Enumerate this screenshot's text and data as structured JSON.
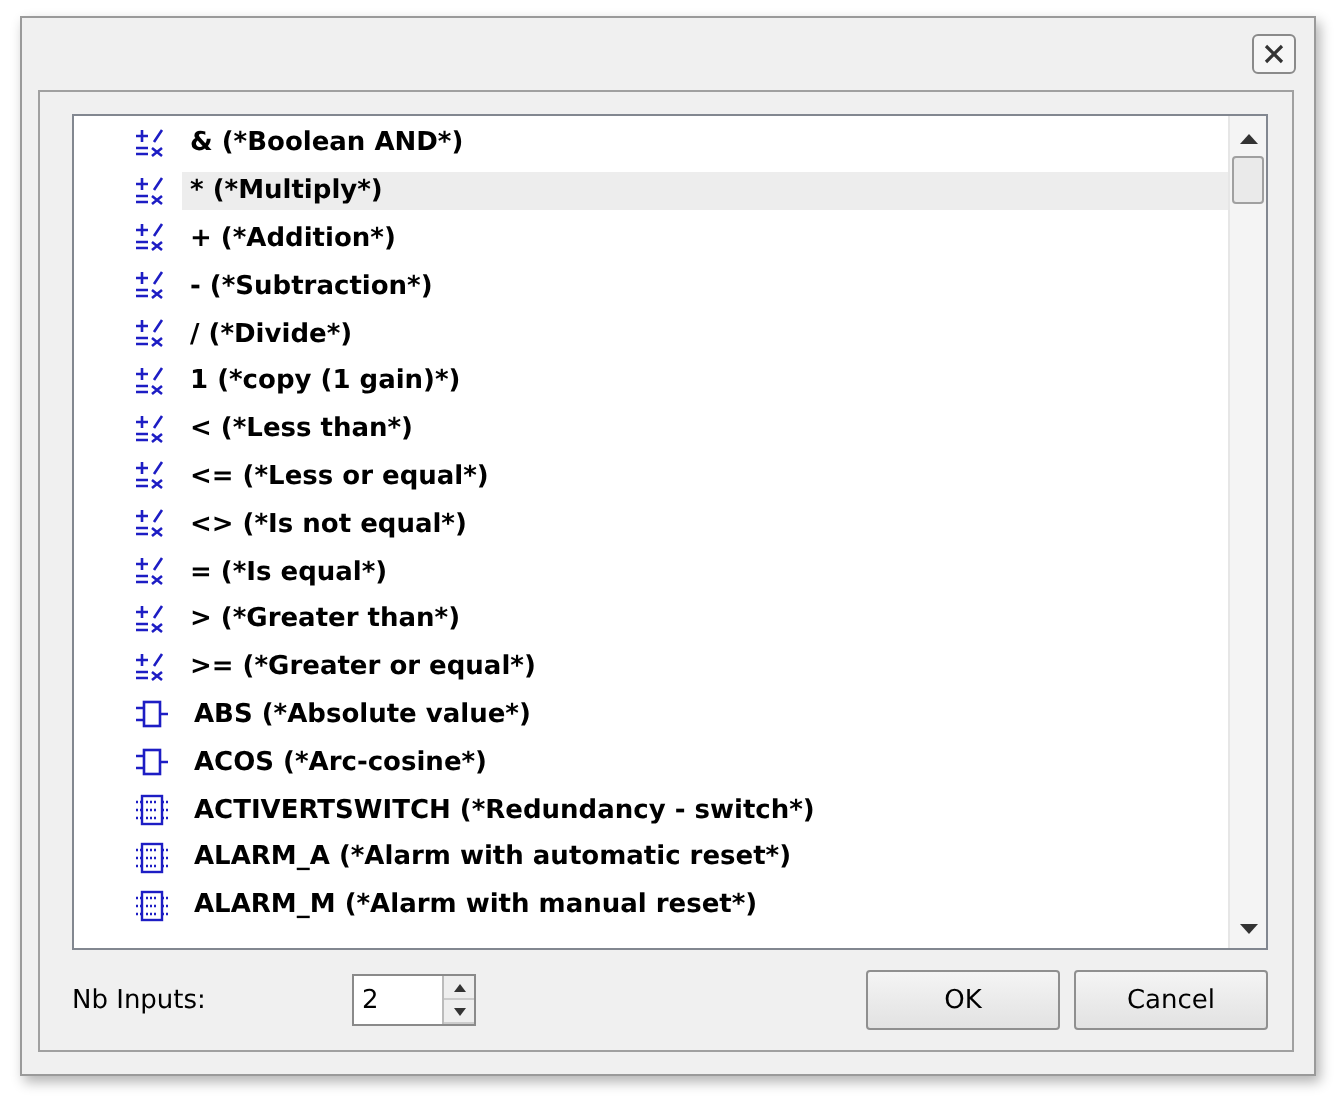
{
  "items": [
    {
      "kind": "operator",
      "label": "& (*Boolean AND*)",
      "selected": false
    },
    {
      "kind": "operator",
      "label": "* (*Multiply*)",
      "selected": true
    },
    {
      "kind": "operator",
      "label": "+ (*Addition*)",
      "selected": false
    },
    {
      "kind": "operator",
      "label": "- (*Subtraction*)",
      "selected": false
    },
    {
      "kind": "operator",
      "label": "/ (*Divide*)",
      "selected": false
    },
    {
      "kind": "operator",
      "label": "1 (*copy (1 gain)*)",
      "selected": false
    },
    {
      "kind": "operator",
      "label": "< (*Less than*)",
      "selected": false
    },
    {
      "kind": "operator",
      "label": "<= (*Less or equal*)",
      "selected": false
    },
    {
      "kind": "operator",
      "label": "<> (*Is not equal*)",
      "selected": false
    },
    {
      "kind": "operator",
      "label": "= (*Is equal*)",
      "selected": false
    },
    {
      "kind": "operator",
      "label": "> (*Greater than*)",
      "selected": false
    },
    {
      "kind": "operator",
      "label": ">= (*Greater or equal*)",
      "selected": false
    },
    {
      "kind": "function",
      "label": "ABS (*Absolute value*)",
      "selected": false
    },
    {
      "kind": "function",
      "label": "ACOS (*Arc-cosine*)",
      "selected": false
    },
    {
      "kind": "block",
      "label": "ACTIVERTSWITCH (*Redundancy - switch*)",
      "selected": false
    },
    {
      "kind": "block",
      "label": "ALARM_A (*Alarm with automatic reset*)",
      "selected": false
    },
    {
      "kind": "block",
      "label": "ALARM_M (*Alarm with manual reset*)",
      "selected": false
    }
  ],
  "inputs": {
    "label": "Nb Inputs:",
    "value": "2"
  },
  "buttons": [
    "OK",
    "Cancel"
  ]
}
